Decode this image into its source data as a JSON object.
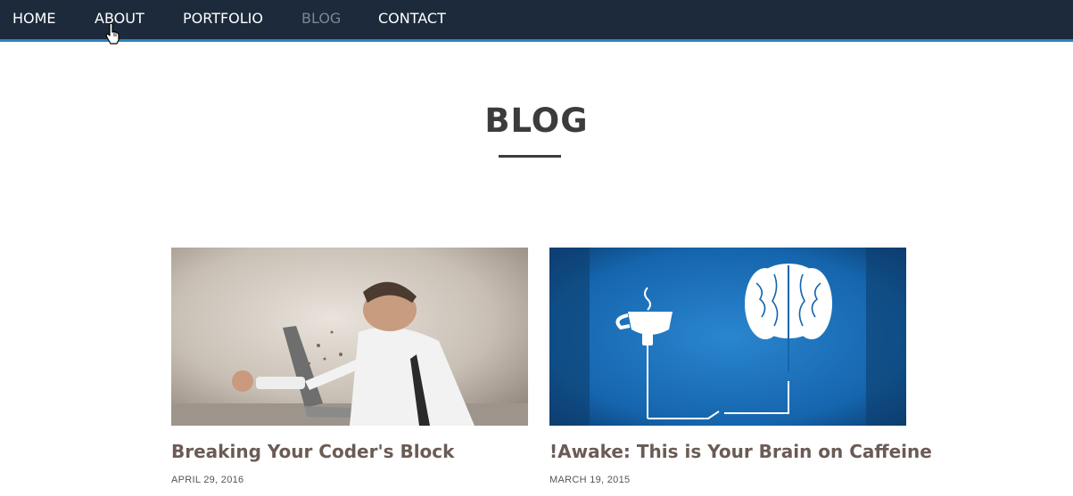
{
  "nav": {
    "items": [
      {
        "label": "HOME"
      },
      {
        "label": "ABOUT"
      },
      {
        "label": "PORTFOLIO"
      },
      {
        "label": "BLOG"
      },
      {
        "label": "CONTACT"
      }
    ],
    "active_item": "BLOG"
  },
  "page": {
    "title": "BLOG"
  },
  "posts": [
    {
      "title": "Breaking Your Coder's Block",
      "date": "APRIL 29, 2016",
      "image": "frustrated-man-punching-through-laptop"
    },
    {
      "title": "!Awake: This is Your Brain on Caffeine",
      "date": "MARCH 19, 2015",
      "image": "coffee-cup-plugged-into-brain"
    }
  ],
  "colors": {
    "navbar_bg": "#1c2a3c",
    "navbar_accent": "#2a86c4",
    "nav_active": "#7e8691",
    "title": "#3c3c3c",
    "post_title": "#6b5b55",
    "post_date": "#555555"
  }
}
